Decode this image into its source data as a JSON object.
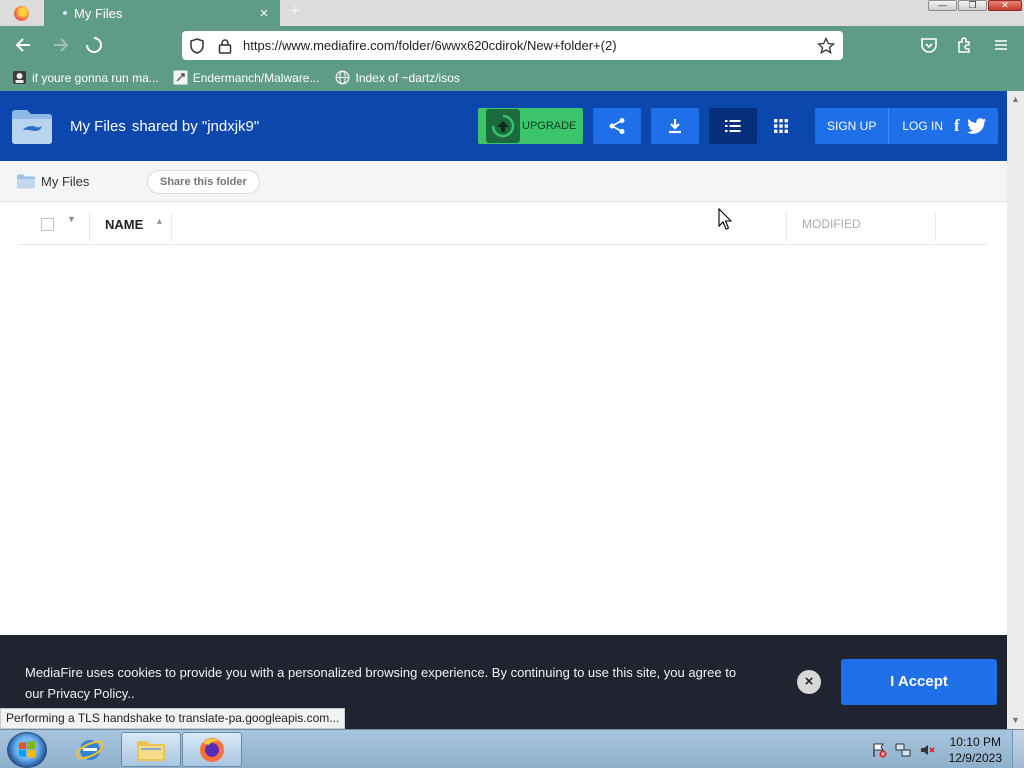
{
  "browser": {
    "tab_title": "My Files",
    "tab_close": "×",
    "new_tab": "+",
    "url": "https://www.mediafire.com/folder/6wwx620cdirok/New+folder+(2)",
    "bookmarks": [
      {
        "label": "if youre gonna run ma...",
        "icon": "person-icon"
      },
      {
        "label": "Endermanch/Malware...",
        "icon": "github-icon"
      },
      {
        "label": "Index of ~dartz/isos",
        "icon": "globe-icon"
      }
    ],
    "status": "Performing a TLS handshake to translate-pa.googleapis.com..."
  },
  "header": {
    "title": "My Files",
    "shared_by": "shared by \"jndxjk9\"",
    "upgrade": "UPGRADE",
    "signup": "SIGN UP",
    "login": "LOG IN",
    "facebook": "f"
  },
  "breadcrumb": {
    "folder": "My Files",
    "share_button": "Share this folder"
  },
  "table": {
    "columns": {
      "name": "NAME",
      "modified": "MODIFIED"
    }
  },
  "cookie": {
    "text": "MediaFire uses cookies to provide you with a personalized browsing experience. By continuing to use this site, you agree to our Privacy Policy..",
    "close": "×",
    "accept": "I Accept"
  },
  "taskbar": {
    "time": "10:10 PM",
    "date": "12/9/2023"
  },
  "colors": {
    "brand_blue": "#0b47ad",
    "button_blue": "#1e6fe8",
    "upgrade_green": "#3cc46a",
    "browser_chrome": "#5f9c86",
    "cookie_bg": "#1f2430"
  }
}
